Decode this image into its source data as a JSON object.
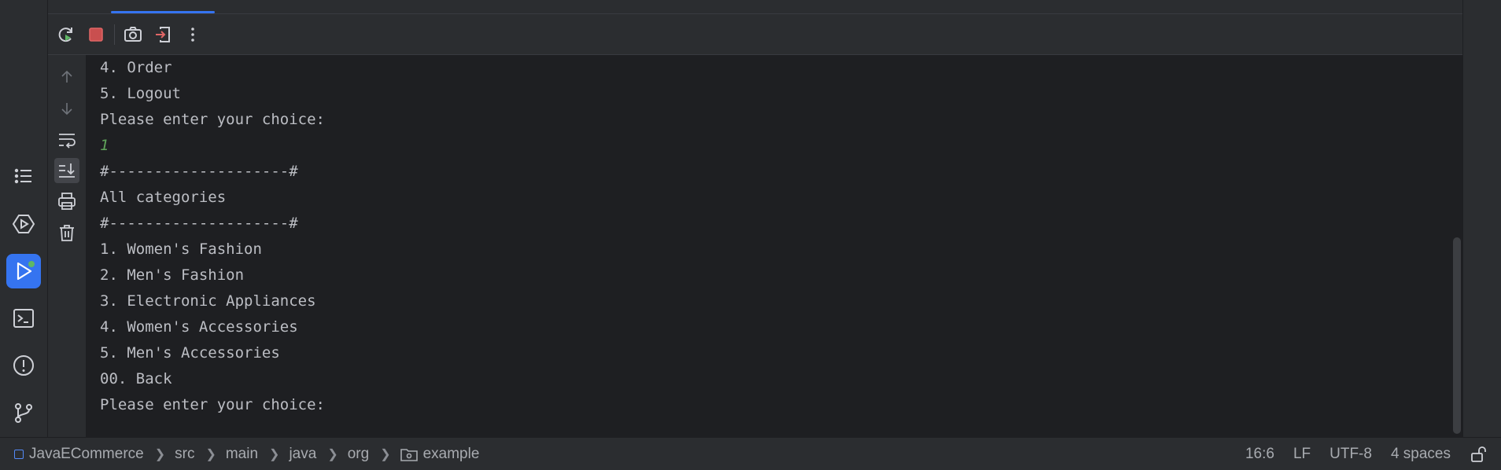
{
  "toolbar": {
    "buttons": [
      "rerun-icon",
      "stop-icon",
      "screenshot-icon",
      "exit-icon",
      "more-icon"
    ]
  },
  "sidebar": {
    "icons": [
      "structure-icon",
      "services-icon",
      "run-icon",
      "terminal-icon",
      "problems-icon",
      "git-icon"
    ],
    "active": "run-icon"
  },
  "console_gutter": {
    "icons": [
      "up-arrow-icon",
      "down-arrow-icon",
      "soft-wrap-icon",
      "scroll-to-end-icon",
      "print-icon",
      "clear-icon"
    ]
  },
  "console": {
    "lines": [
      {
        "text": "4. Order",
        "type": "output"
      },
      {
        "text": "5. Logout",
        "type": "output"
      },
      {
        "text": "Please enter your choice:",
        "type": "output"
      },
      {
        "text": "1",
        "type": "input"
      },
      {
        "text": "#--------------------#",
        "type": "output"
      },
      {
        "text": "All categories",
        "type": "output"
      },
      {
        "text": "#--------------------#",
        "type": "output"
      },
      {
        "text": "1. Women's Fashion",
        "type": "output"
      },
      {
        "text": "2. Men's Fashion",
        "type": "output"
      },
      {
        "text": "3. Electronic Appliances",
        "type": "output"
      },
      {
        "text": "4. Women's Accessories",
        "type": "output"
      },
      {
        "text": "5. Men's Accessories",
        "type": "output"
      },
      {
        "text": "00. Back",
        "type": "output"
      },
      {
        "text": "Please enter your choice:",
        "type": "output"
      }
    ]
  },
  "statusbar": {
    "breadcrumb": [
      "JavaECommerce",
      "src",
      "main",
      "java",
      "org",
      "example"
    ],
    "position": "16:6",
    "line_ending": "LF",
    "encoding": "UTF-8",
    "indent": "4 spaces"
  },
  "colors": {
    "accent": "#3574f0",
    "input_text": "#5fa35a",
    "stop": "#c94f4f"
  }
}
